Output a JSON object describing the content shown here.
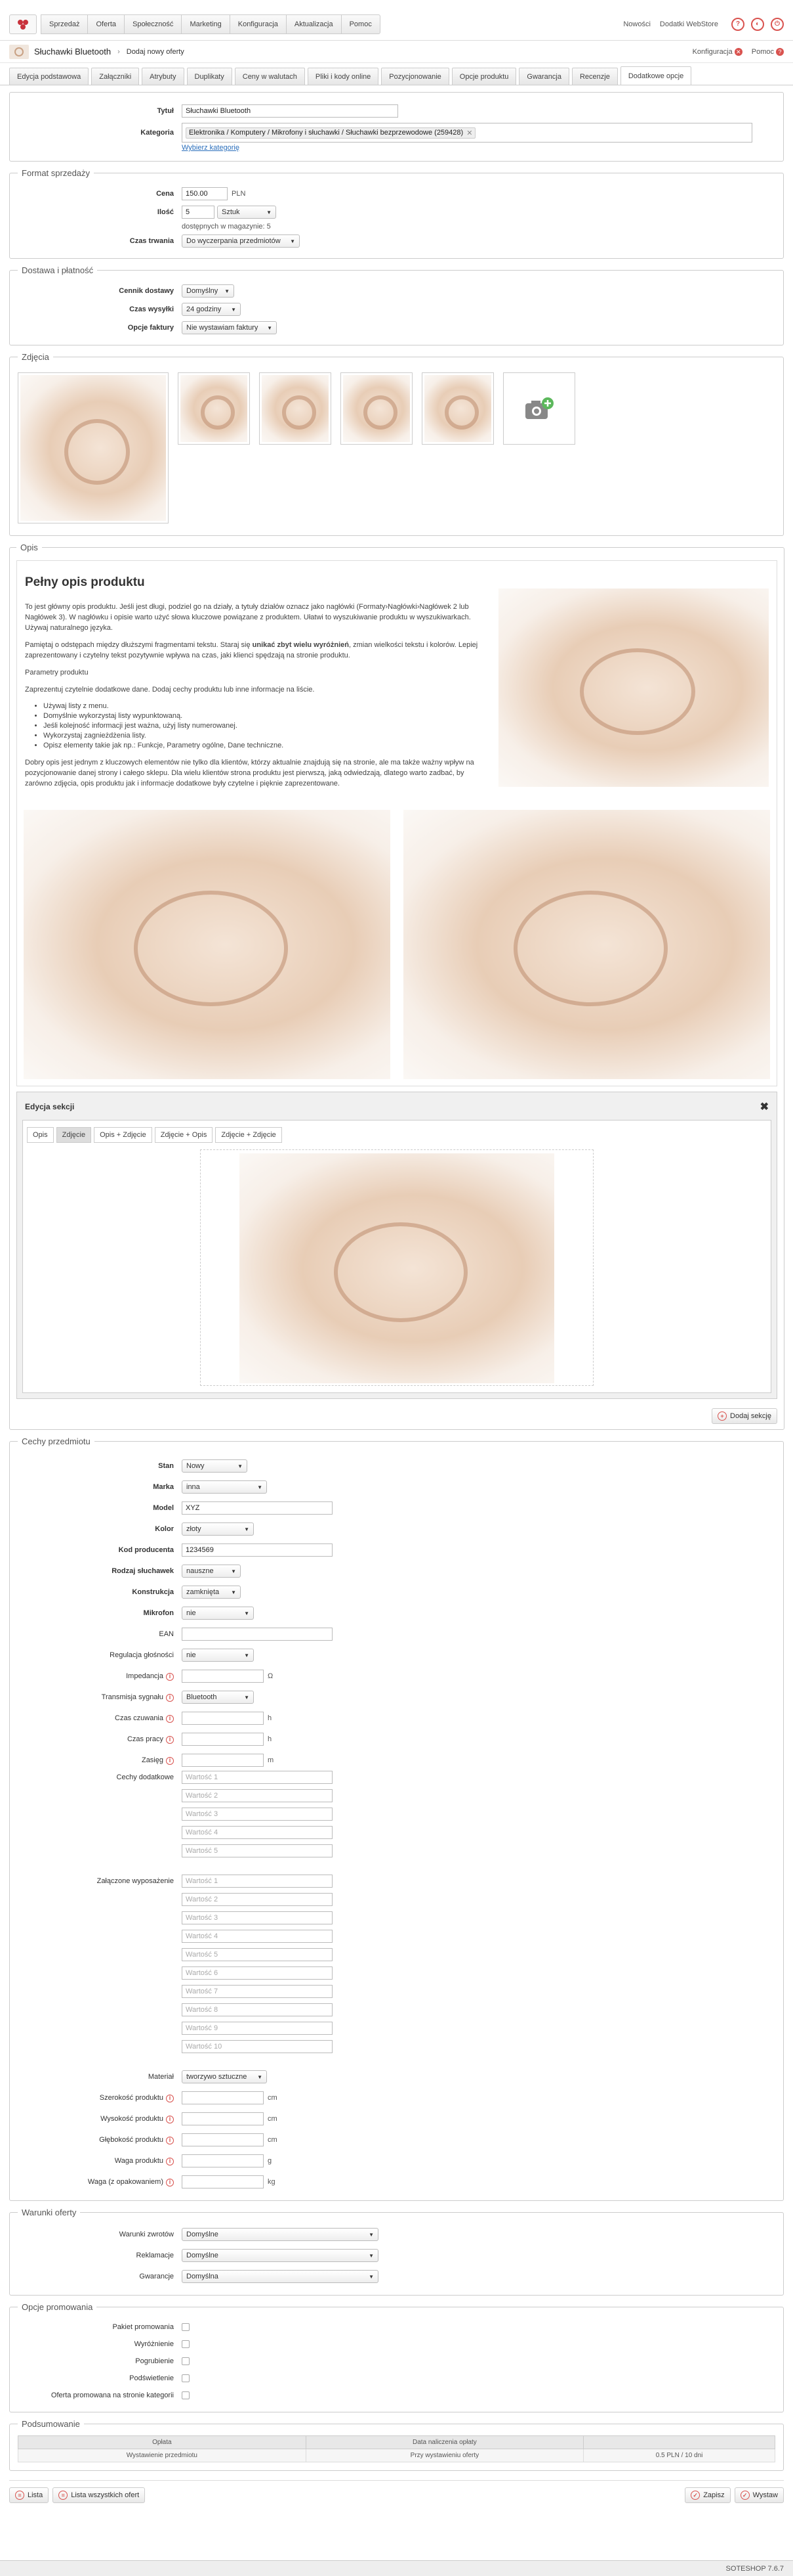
{
  "topmenu": [
    "Sprzedaż",
    "Oferta",
    "Społeczność",
    "Marketing",
    "Konfiguracja",
    "Aktualizacja",
    "Pomoc"
  ],
  "topright": {
    "news": "Nowości",
    "addons": "Dodatki WebStore"
  },
  "breadcrumb": {
    "product": "Słuchawki Bluetooth",
    "action": "Dodaj nowy oferty",
    "config": "Konfiguracja",
    "help": "Pomoc"
  },
  "tabs": [
    "Edycja podstawowa",
    "Załączniki",
    "Atrybuty",
    "Duplikaty",
    "Ceny w walutach",
    "Pliki i kody online",
    "Pozycjonowanie",
    "Opcje produktu",
    "Gwarancja",
    "Recenzje",
    "Dodatkowe opcje"
  ],
  "basic": {
    "title_label": "Tytuł",
    "title_value": "Słuchawki Bluetooth",
    "category_label": "Kategoria",
    "category_value": "Elektronika / Komputery / Mikrofony i słuchawki / Słuchawki bezprzewodowe (259428)",
    "choose_category": "Wybierz kategorię"
  },
  "sale": {
    "legend": "Format sprzedaży",
    "price_label": "Cena",
    "price_value": "150.00",
    "currency": "PLN",
    "qty_label": "Ilość",
    "qty_value": "5",
    "qty_unit": "Sztuk",
    "available": "dostępnych w magazynie: 5",
    "duration_label": "Czas trwania",
    "duration_value": "Do wyczerpania przedmiotów"
  },
  "delivery": {
    "legend": "Dostawa i płatność",
    "price_list_label": "Cennik dostawy",
    "price_list_value": "Domyślny",
    "ship_time_label": "Czas wysyłki",
    "ship_time_value": "24 godziny",
    "invoice_label": "Opcje faktury",
    "invoice_value": "Nie wystawiam faktury"
  },
  "photos": {
    "legend": "Zdjęcia"
  },
  "description": {
    "legend": "Opis",
    "heading": "Pełny opis produktu",
    "p1": "To jest główny opis produktu. Jeśli jest długi, podziel go na działy, a tytuły działów oznacz jako nagłówki (Formaty›Nagłówki›Nagłówek 2 lub Nagłówek 3). W nagłówku i opisie warto użyć słowa kluczowe powiązane z produktem. Ułatwi to wyszukiwanie produktu w wyszukiwarkach. Używaj naturalnego języka.",
    "p2a": "Pamiętaj o odstępach między dłuższymi fragmentami tekstu. Staraj się ",
    "p2b": "unikać zbyt wielu wyróżnień",
    "p2c": ", zmian wielkości tekstu i kolorów. Lepiej zaprezentowany i czytelny tekst pozytywnie wpływa na czas, jaki klienci spędzają na stronie produktu.",
    "p3": "Parametry produktu",
    "p4": "Zaprezentuj czytelnie dodatkowe dane. Dodaj cechy produktu lub inne informacje na liście.",
    "list": [
      "Używaj listy z menu.",
      "Domyślnie wykorzystaj listy wypunktowaną.",
      "Jeśli kolejność informacji jest ważna, użyj listy numerowanej.",
      "Wykorzystaj zagnieżdżenia listy.",
      "Opisz elementy takie jak np.: Funkcje, Parametry ogólne, Dane techniczne."
    ],
    "p5": "Dobry opis jest jednym z kluczowych elementów nie tylko dla klientów, którzy aktualnie znajdują się na stronie, ale ma także ważny wpływ na pozycjonowanie danej strony i całego sklepu. Dla wielu klientów strona produktu jest pierwszą, jaką odwiedzają, dlatego warto zadbać, by zarówno zdjęcia, opis produktu jak i informacje dodatkowe były czytelne i pięknie zaprezentowane."
  },
  "section_edit": {
    "title": "Edycja sekcji",
    "tabs": [
      "Opis",
      "Zdjęcie",
      "Opis + Zdjęcie",
      "Zdjęcie + Opis",
      "Zdjęcie + Zdjęcie"
    ],
    "add": "Dodaj sekcję"
  },
  "features": {
    "legend": "Cechy przedmiotu",
    "state": {
      "label": "Stan",
      "value": "Nowy"
    },
    "brand": {
      "label": "Marka",
      "value": "inna"
    },
    "model": {
      "label": "Model",
      "value": "XYZ"
    },
    "color": {
      "label": "Kolor",
      "value": "złoty"
    },
    "code": {
      "label": "Kod producenta",
      "value": "1234569"
    },
    "type": {
      "label": "Rodzaj słuchawek",
      "value": "nauszne"
    },
    "construction": {
      "label": "Konstrukcja",
      "value": "zamknięta"
    },
    "mic": {
      "label": "Mikrofon",
      "value": "nie"
    },
    "ean": {
      "label": "EAN"
    },
    "volume": {
      "label": "Regulacja głośności",
      "value": "nie"
    },
    "impedance": {
      "label": "Impedancja",
      "unit": "Ω"
    },
    "transmission": {
      "label": "Transmisja sygnału",
      "value": "Bluetooth"
    },
    "standby": {
      "label": "Czas czuwania",
      "unit": "h"
    },
    "worktime": {
      "label": "Czas pracy",
      "unit": "h"
    },
    "range": {
      "label": "Zasięg",
      "unit": "m"
    },
    "extra": {
      "label": "Cechy dodatkowe",
      "values": [
        "Wartość 1",
        "Wartość 2",
        "Wartość 3",
        "Wartość 4",
        "Wartość 5"
      ]
    },
    "equipment": {
      "label": "Załączone wyposażenie",
      "values": [
        "Wartość 1",
        "Wartość 2",
        "Wartość 3",
        "Wartość 4",
        "Wartość 5",
        "Wartość 6",
        "Wartość 7",
        "Wartość 8",
        "Wartość 9",
        "Wartość 10"
      ]
    },
    "material": {
      "label": "Materiał",
      "value": "tworzywo sztuczne"
    },
    "width": {
      "label": "Szerokość produktu",
      "unit": "cm"
    },
    "height": {
      "label": "Wysokość produktu",
      "unit": "cm"
    },
    "depth": {
      "label": "Głębokość produktu",
      "unit": "cm"
    },
    "weight": {
      "label": "Waga produktu",
      "unit": "g"
    },
    "weight_pack": {
      "label": "Waga (z opakowaniem)",
      "unit": "kg"
    }
  },
  "conditions": {
    "legend": "Warunki oferty",
    "returns_label": "Warunki zwrotów",
    "returns_value": "Domyślne",
    "complaints_label": "Reklamacje",
    "complaints_value": "Domyślne",
    "warranty_label": "Gwarancje",
    "warranty_value": "Domyślna"
  },
  "promo": {
    "legend": "Opcje promowania",
    "items": [
      "Pakiet promowania",
      "Wyróżnienie",
      "Pogrubienie",
      "Podświetlenie",
      "Oferta promowana na stronie kategorii"
    ]
  },
  "summary": {
    "legend": "Podsumowanie",
    "col1": "Opłata",
    "col2": "Data naliczenia opłaty",
    "col3": "",
    "row_fee": "Wystawienie przedmiotu",
    "row_date": "Przy wystawieniu oferty",
    "row_amount": "0.5 PLN / 10 dni"
  },
  "bottom": {
    "list": "Lista",
    "list_all": "Lista wszystkich ofert",
    "save": "Zapisz",
    "publish": "Wystaw"
  },
  "footer": "SOTESHOP 7.6.7"
}
